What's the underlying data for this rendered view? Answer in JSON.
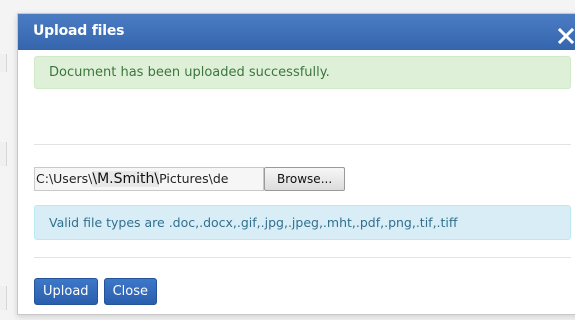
{
  "dialog": {
    "title": "Upload files",
    "close_icon": "close-icon"
  },
  "success_alert": {
    "text": "Document has been uploaded successfully."
  },
  "file_input": {
    "path_prefix": "C:\\Users\\",
    "path_highlight": "\\M.Smith\\",
    "path_suffix": "Pictures\\de",
    "browse_label": "Browse..."
  },
  "info_alert": {
    "text": "Valid file types are .doc,.docx,.gif,.jpg,.jpeg,.mht,.pdf,.png,.tif,.tiff"
  },
  "buttons": {
    "upload_label": "Upload",
    "close_label": "Close"
  },
  "colors": {
    "titlebar": "#3d6fb8",
    "success_bg": "#dff0d8",
    "success_text": "#3c763d",
    "info_bg": "#d9edf7",
    "info_text": "#31708f",
    "primary_button": "#2f67b8"
  }
}
